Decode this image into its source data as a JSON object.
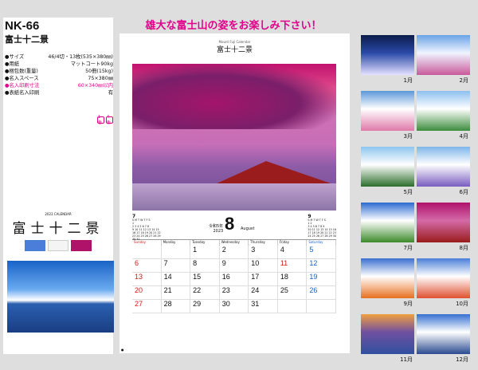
{
  "product": {
    "code": "NK-66",
    "name": "富士十二景",
    "specs": [
      {
        "label": "●サイズ",
        "value": "46/4切・13枚(535×380㎜)",
        "pink": false
      },
      {
        "label": "●用紙",
        "value": "マットコート90kg",
        "pink": false
      },
      {
        "label": "●梱包数(重量)",
        "value": "50冊(15kg)",
        "pink": false
      },
      {
        "label": "●名入スペース",
        "value": "75×380㎜",
        "pink": false
      },
      {
        "label": "●名入印刷寸法",
        "value": "60×340㎜以内",
        "pink": true
      },
      {
        "label": "●表紙名入印刷",
        "value": "有",
        "pink": false
      }
    ],
    "badges": [
      "1色",
      "4色"
    ]
  },
  "cover": {
    "header": "2023 CALENDAR",
    "title": "富士十二景"
  },
  "headline": "雄大な富士山の姿をお楽しみ下さい！",
  "calendar": {
    "top_small": "Mount Fuji Calendar",
    "top_title": "富士十二景",
    "month_num": "8",
    "month_name": "August",
    "era": "令和5年",
    "year": "2023",
    "prev": {
      "num": "7",
      "rows": [
        "S M T W T F S",
        "      1",
        "2 3 4 5 6 7 8",
        "9 10 11 12 13 14 15",
        "16 17 18 19 20 21 22",
        "23 24 25 26 27 28 29",
        "30 31"
      ]
    },
    "next": {
      "num": "9",
      "rows": [
        "S M T W T F S",
        "         1 2",
        "3 4 5 6 7 8 9",
        "10 11 12 13 14 15 16",
        "17 18 19 20 21 22 23",
        "24 25 26 27 28 29 30"
      ]
    },
    "weekdays": [
      "Sunday",
      "Monday",
      "Tuesday",
      "Wednesday",
      "Thursday",
      "Friday",
      "Saturday"
    ],
    "weeks": [
      [
        "",
        "",
        "1",
        "2",
        "3",
        "4",
        "5"
      ],
      [
        "6",
        "7",
        "8",
        "9",
        "10",
        "11",
        "12"
      ],
      [
        "13",
        "14",
        "15",
        "16",
        "17",
        "18",
        "19"
      ],
      [
        "20",
        "21",
        "22",
        "23",
        "24",
        "25",
        "26"
      ],
      [
        "27",
        "28",
        "29",
        "30",
        "31",
        "",
        ""
      ]
    ],
    "holidays": [
      "11"
    ],
    "footer": "●"
  },
  "months": [
    {
      "label": "1月",
      "colors": [
        "#0b1b4a",
        "#2a4aa8",
        "#e6e0ff"
      ]
    },
    {
      "label": "2月",
      "colors": [
        "#6aa4e6",
        "#f0f4ff",
        "#c85a9a"
      ]
    },
    {
      "label": "3月",
      "colors": [
        "#5b97d8",
        "#ffffff",
        "#e07aa8"
      ]
    },
    {
      "label": "4月",
      "colors": [
        "#8cc0ef",
        "#ffffff",
        "#3c8c3c"
      ]
    },
    {
      "label": "5月",
      "colors": [
        "#8cc6ee",
        "#ffffff",
        "#2b6e2b"
      ]
    },
    {
      "label": "6月",
      "colors": [
        "#7eb6ea",
        "#ffffff",
        "#7a5cc0"
      ]
    },
    {
      "label": "7月",
      "colors": [
        "#2b6ad0",
        "#ffffff",
        "#3c8a2a"
      ]
    },
    {
      "label": "8月",
      "colors": [
        "#b0126a",
        "#d46aa8",
        "#9a1c1c"
      ]
    },
    {
      "label": "9月",
      "colors": [
        "#3a6fd0",
        "#ffffff",
        "#e87020"
      ]
    },
    {
      "label": "10月",
      "colors": [
        "#4a7ed8",
        "#ffffff",
        "#e05030"
      ]
    },
    {
      "label": "11月",
      "colors": [
        "#f0a040",
        "#7050a0",
        "#3050a0"
      ]
    },
    {
      "label": "12月",
      "colors": [
        "#3570d0",
        "#ffffff",
        "#2a4a90"
      ]
    }
  ]
}
